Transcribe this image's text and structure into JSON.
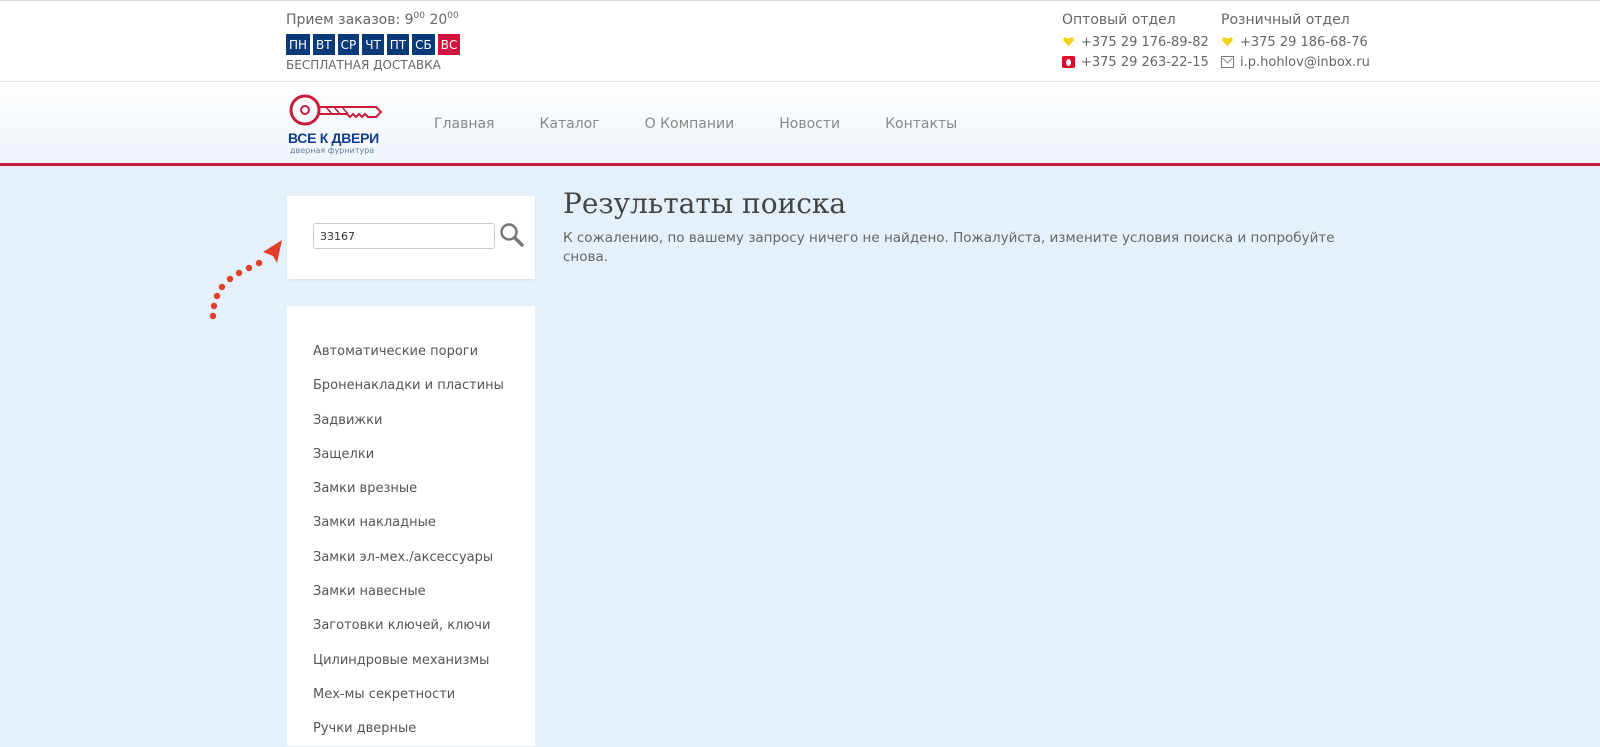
{
  "header": {
    "hours_label": "Прием заказов: 9",
    "hours_sup1": "00",
    "hours_mid": "20",
    "hours_sup2": "00",
    "days": [
      "ПН",
      "ВТ",
      "СР",
      "ЧТ",
      "ПТ",
      "СБ",
      "ВС"
    ],
    "delivery": "БЕСПЛАТНАЯ ДОСТАВКА",
    "wholesale": {
      "title": "Оптовый отдел",
      "phone1": "+375 29 176-89-82",
      "phone2": "+375 29 263-22-15"
    },
    "retail": {
      "title": "Розничный отдел",
      "phone": "+375 29 186-68-76",
      "email": "i.p.hohlov@inbox.ru"
    }
  },
  "logo": {
    "name": "ВСЕ К ДВЕРИ",
    "tagline": "дверная фурнитура"
  },
  "nav": {
    "items": [
      "Главная",
      "Каталог",
      "О Компании",
      "Новости",
      "Контакты"
    ]
  },
  "search": {
    "value": "33167"
  },
  "categories": [
    "Автоматические пороги",
    "Броненакладки и пластины",
    "Задвижки",
    "Защелки",
    "Замки врезные",
    "Замки накладные",
    "Замки эл-мех./аксессуары",
    "Замки навесные",
    "Заготовки ключей, ключи",
    "Цилиндровые механизмы",
    "Мех-мы секретности",
    "Ручки дверные"
  ],
  "main": {
    "title": "Результаты поиска",
    "message": "К сожалению, по вашему запросу ничего не найдено. Пожалуйста, измените условия поиска и попробуйте снова."
  },
  "colors": {
    "day_blue": "#0b3a7a",
    "day_red": "#d1143f",
    "accent_red": "#c71d3a",
    "logo_blue": "#113d8c"
  }
}
